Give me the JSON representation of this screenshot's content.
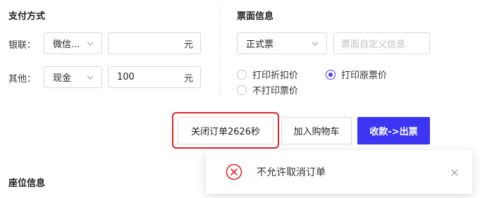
{
  "payment": {
    "title": "支付方式",
    "unionpay_label": "银联：",
    "unionpay_method": "微信...",
    "unionpay_amount": "",
    "unit": "元",
    "other_label": "其他：",
    "other_method": "现金",
    "other_amount": "100"
  },
  "ticket": {
    "title": "票面信息",
    "ticket_type": "正式票",
    "custom_placeholder": "票面自定义信息",
    "price_options": [
      {
        "label": "打印折扣价",
        "checked": false
      },
      {
        "label": "打印原票价",
        "checked": true
      },
      {
        "label": "不打印票价",
        "checked": false
      }
    ]
  },
  "actions": {
    "close_order": "关闭订单2626秒",
    "add_cart": "加入购物车",
    "checkout": "收款->出票"
  },
  "seat": {
    "title": "座位信息"
  },
  "toast": {
    "message": "不允许取消订单"
  },
  "colors": {
    "primary": "#3c36f4",
    "error": "#e0262b",
    "radio_accent": "#4a3aff"
  }
}
